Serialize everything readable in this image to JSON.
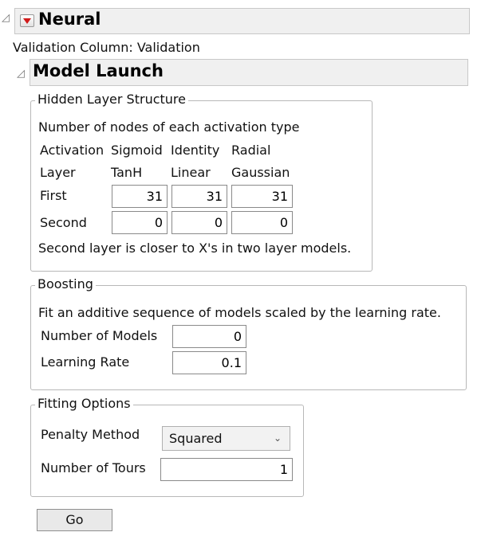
{
  "neural": {
    "title": "Neural",
    "validation": "Validation Column: Validation"
  },
  "model_launch": {
    "title": "Model Launch"
  },
  "hidden_layer": {
    "legend": "Hidden Layer Structure",
    "description": "Number of nodes of each activation type",
    "header_activation": "Activation",
    "header_layer": "Layer",
    "col1_top": "Sigmoid",
    "col1_bottom": "TanH",
    "col2_top": "Identity",
    "col2_bottom": "Linear",
    "col3_top": "Radial",
    "col3_bottom": "Gaussian",
    "rows": [
      {
        "label": "First",
        "tanh": "31",
        "linear": "31",
        "gaussian": "31"
      },
      {
        "label": "Second",
        "tanh": "0",
        "linear": "0",
        "gaussian": "0"
      }
    ],
    "note": "Second layer is closer to X's in two layer models."
  },
  "boosting": {
    "legend": "Boosting",
    "description": "Fit an additive sequence of models scaled by the learning rate.",
    "num_models_label": "Number of Models",
    "num_models_value": "0",
    "learning_rate_label": "Learning Rate",
    "learning_rate_value": "0.1"
  },
  "fitting": {
    "legend": "Fitting Options",
    "penalty_label": "Penalty Method",
    "penalty_value": "Squared",
    "tours_label": "Number of Tours",
    "tours_value": "1"
  },
  "go_label": "Go",
  "icons": {
    "disclosure": "disclosure-triangle-icon",
    "hotspot": "red-triangle-menu-icon",
    "dropdown": "chevron-down-icon"
  },
  "colors": {
    "hotspot_red": "#d11a1a",
    "header_bg": "#f0f0f0"
  }
}
